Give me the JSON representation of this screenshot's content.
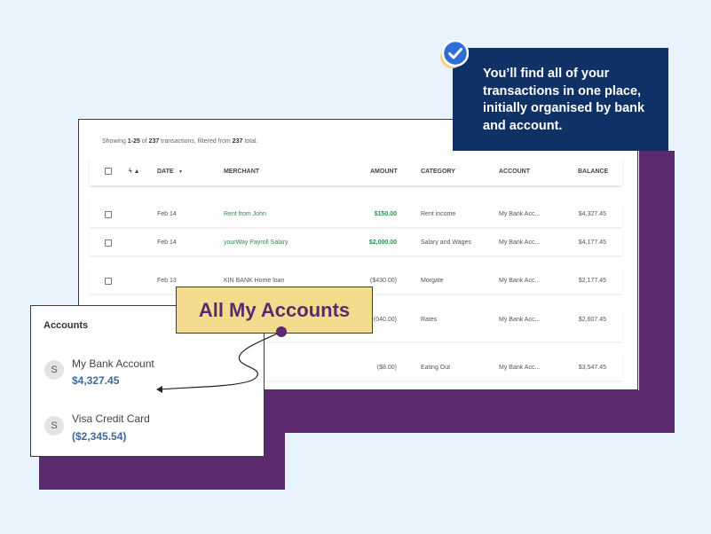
{
  "tooltip": {
    "text": "You’ll find all of your transactions in one place, initially organised by bank and account."
  },
  "transactions": {
    "summary": {
      "prefix": "Showing ",
      "range": "1-25",
      "mid": " of ",
      "count": "237",
      "filtered_text": " transactions, filtered from ",
      "total": "237",
      "suffix": " total."
    },
    "headers": {
      "flags": "ϟ ▲",
      "date": "DATE",
      "date_sort": "▼",
      "merchant": "MERCHANT",
      "amount": "AMOUNT",
      "category": "CATEGORY",
      "account": "ACCOUNT",
      "balance": "BALANCE"
    },
    "rows": [
      {
        "date": "Feb 14",
        "merchant": "Rent from John",
        "amount": "$150.00",
        "category": "Rent income",
        "account": "My Bank Acc...",
        "balance": "$4,327.45"
      },
      {
        "date": "Feb 14",
        "merchant": "yourWay Payroll Salary",
        "amount": "$2,000.00",
        "category": "Salary and Wages",
        "account": "My Bank Acc...",
        "balance": "$4,177.45"
      },
      {
        "date": "Feb 13",
        "merchant": "KIN BANK Home loan",
        "amount": "($430.00)",
        "category": "Morgate",
        "account": "My Bank Acc...",
        "balance": "$2,177.45"
      },
      {
        "date": "",
        "merchant": "",
        "amount": "(040.00)",
        "category": "Rates",
        "account": "My Bank Acc...",
        "balance": "$2,607.45"
      },
      {
        "date": "",
        "merchant": "",
        "amount": "($8.00)",
        "category": "Eating Out",
        "account": "My Bank Acc...",
        "balance": "$3,547.45"
      }
    ]
  },
  "label": {
    "text": "All My Accounts"
  },
  "accounts": {
    "title": "Accounts",
    "items": [
      {
        "initial": "S",
        "name": "My Bank Account",
        "balance": "$4,327.45"
      },
      {
        "initial": "S",
        "name": "Visa Credit Card",
        "balance": "($2,345.54)"
      }
    ]
  },
  "colors": {
    "background": "#e8f3fd",
    "purple": "#5b2a6e",
    "navy": "#0f3166",
    "label_yellow": "#f4dc8e",
    "check_blue": "#2d6fd6",
    "positive_green": "#2f8a4f",
    "balance_blue": "#3d6a9a"
  }
}
